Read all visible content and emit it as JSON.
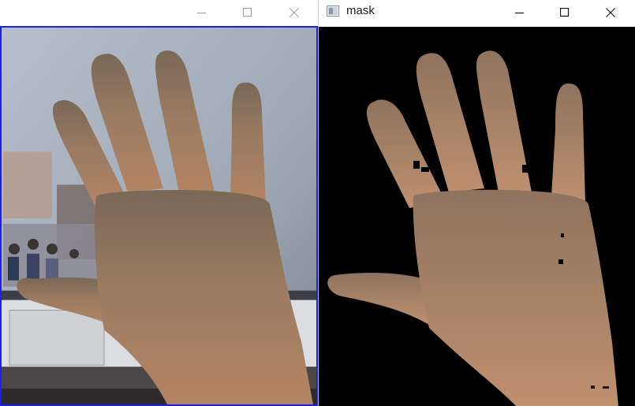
{
  "windows": {
    "left": {
      "title": "",
      "controls": {
        "minimize": "minimize-icon",
        "maximize": "maximize-icon",
        "close": "close-icon"
      }
    },
    "right": {
      "title": "mask",
      "app_icon": "window-app-icon",
      "controls": {
        "minimize": "minimize-icon",
        "maximize": "maximize-icon",
        "close": "close-icon"
      }
    }
  },
  "colors": {
    "frame_border": "#1d1df0",
    "mask_background": "#000000",
    "skin": "#a57a5c",
    "wall": "#a7b0bc"
  }
}
